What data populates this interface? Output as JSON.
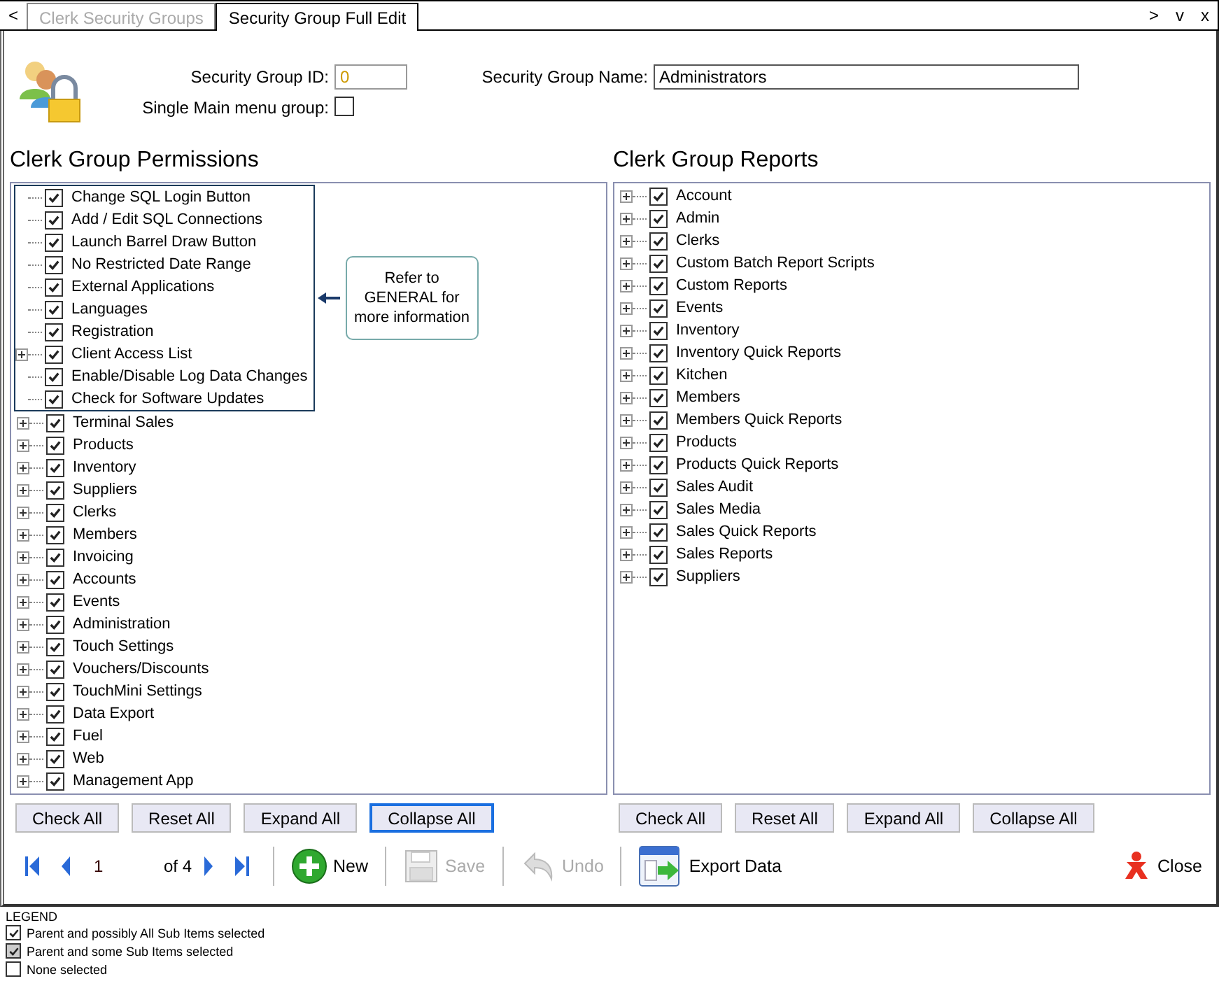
{
  "tab_bar": {
    "back": "<",
    "forward": ">",
    "menu": "v",
    "close": "x"
  },
  "tabs": [
    {
      "label": "Clerk Security Groups",
      "selected": false,
      "disabled": true
    },
    {
      "label": "Security Group Full Edit",
      "selected": true,
      "disabled": false
    }
  ],
  "header": {
    "id_label": "Security Group ID:",
    "id_value": "0",
    "name_label": "Security Group Name:",
    "name_value": "Administrators",
    "single_menu_label": "Single Main menu group:",
    "single_menu_checked": false
  },
  "permissions": {
    "title": "Clerk Group Permissions",
    "callout_items": [
      {
        "label": "Change SQL Login Button",
        "checked": true,
        "expandable": false
      },
      {
        "label": "Add / Edit SQL Connections",
        "checked": true,
        "expandable": false
      },
      {
        "label": "Launch Barrel Draw Button",
        "checked": true,
        "expandable": false
      },
      {
        "label": "No Restricted Date Range",
        "checked": true,
        "expandable": false
      },
      {
        "label": "External Applications",
        "checked": true,
        "expandable": false
      },
      {
        "label": "Languages",
        "checked": true,
        "expandable": false
      },
      {
        "label": "Registration",
        "checked": true,
        "expandable": false
      },
      {
        "label": "Client Access List",
        "checked": true,
        "expandable": true
      },
      {
        "label": "Enable/Disable Log Data Changes",
        "checked": true,
        "expandable": false
      },
      {
        "label": "Check for Software Updates",
        "checked": true,
        "expandable": false
      }
    ],
    "callout_note": "Refer to GENERAL for more information",
    "items": [
      {
        "label": "Terminal Sales",
        "checked": true,
        "expandable": true
      },
      {
        "label": "Products",
        "checked": true,
        "expandable": true
      },
      {
        "label": "Inventory",
        "checked": true,
        "expandable": true
      },
      {
        "label": "Suppliers",
        "checked": true,
        "expandable": true
      },
      {
        "label": "Clerks",
        "checked": true,
        "expandable": true
      },
      {
        "label": "Members",
        "checked": true,
        "expandable": true
      },
      {
        "label": "Invoicing",
        "checked": true,
        "expandable": true
      },
      {
        "label": "Accounts",
        "checked": true,
        "expandable": true
      },
      {
        "label": "Events",
        "checked": true,
        "expandable": true
      },
      {
        "label": "Administration",
        "checked": true,
        "expandable": true
      },
      {
        "label": "Touch Settings",
        "checked": true,
        "expandable": true
      },
      {
        "label": "Vouchers/Discounts",
        "checked": true,
        "expandable": true
      },
      {
        "label": "TouchMini Settings",
        "checked": true,
        "expandable": true
      },
      {
        "label": "Data Export",
        "checked": true,
        "expandable": true
      },
      {
        "label": "Fuel",
        "checked": true,
        "expandable": true
      },
      {
        "label": "Web",
        "checked": true,
        "expandable": true
      },
      {
        "label": "Management App",
        "checked": true,
        "expandable": true
      }
    ],
    "buttons": [
      {
        "label": "Check All",
        "focused": false
      },
      {
        "label": "Reset All",
        "focused": false
      },
      {
        "label": "Expand All",
        "focused": false
      },
      {
        "label": "Collapse All",
        "focused": true
      }
    ]
  },
  "reports": {
    "title": "Clerk Group Reports",
    "items": [
      {
        "label": "Account",
        "checked": true,
        "expandable": true
      },
      {
        "label": "Admin",
        "checked": true,
        "expandable": true
      },
      {
        "label": "Clerks",
        "checked": true,
        "expandable": true
      },
      {
        "label": "Custom Batch Report Scripts",
        "checked": true,
        "expandable": true
      },
      {
        "label": "Custom Reports",
        "checked": true,
        "expandable": true
      },
      {
        "label": "Events",
        "checked": true,
        "expandable": true
      },
      {
        "label": "Inventory",
        "checked": true,
        "expandable": true
      },
      {
        "label": "Inventory Quick Reports",
        "checked": true,
        "expandable": true
      },
      {
        "label": "Kitchen",
        "checked": true,
        "expandable": true
      },
      {
        "label": "Members",
        "checked": true,
        "expandable": true
      },
      {
        "label": "Members Quick Reports",
        "checked": true,
        "expandable": true
      },
      {
        "label": "Products",
        "checked": true,
        "expandable": true
      },
      {
        "label": "Products Quick Reports",
        "checked": true,
        "expandable": true
      },
      {
        "label": "Sales Audit",
        "checked": true,
        "expandable": true
      },
      {
        "label": "Sales Media",
        "checked": true,
        "expandable": true
      },
      {
        "label": "Sales Quick Reports",
        "checked": true,
        "expandable": true
      },
      {
        "label": "Sales Reports",
        "checked": true,
        "expandable": true
      },
      {
        "label": "Suppliers",
        "checked": true,
        "expandable": true
      }
    ],
    "buttons": [
      {
        "label": "Check All",
        "focused": false
      },
      {
        "label": "Reset All",
        "focused": false
      },
      {
        "label": "Expand All",
        "focused": false
      },
      {
        "label": "Collapse All",
        "focused": false
      }
    ]
  },
  "toolbar": {
    "record": "1",
    "of_total": "of 4",
    "actions": [
      {
        "kind": "new",
        "label": "New",
        "disabled": false
      },
      {
        "kind": "save",
        "label": "Save",
        "disabled": true
      },
      {
        "kind": "undo",
        "label": "Undo",
        "disabled": true
      },
      {
        "kind": "export",
        "label": "Export Data",
        "disabled": false
      }
    ],
    "close": "Close"
  },
  "legend": {
    "title": "LEGEND",
    "items": [
      {
        "kind": "checked",
        "label": "Parent and possibly All Sub Items selected"
      },
      {
        "kind": "partial",
        "label": "Parent and some Sub Items selected"
      },
      {
        "kind": "none",
        "label": "None selected"
      }
    ]
  }
}
